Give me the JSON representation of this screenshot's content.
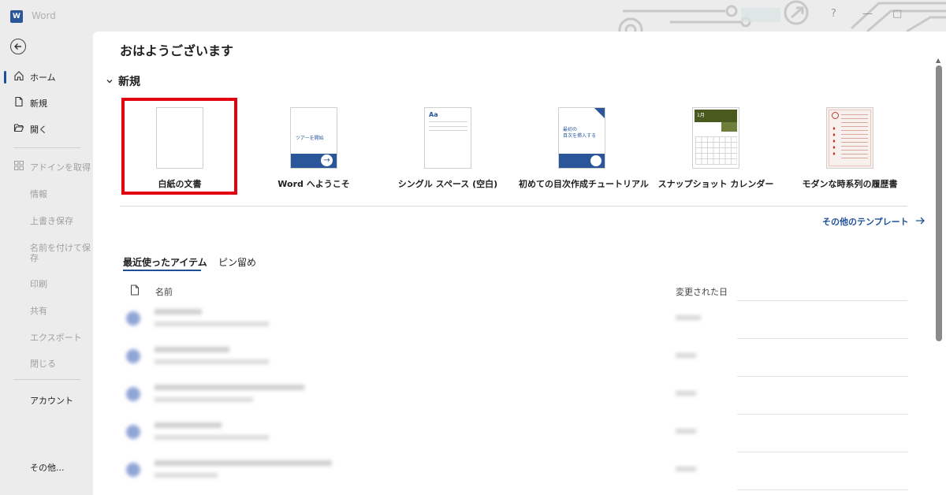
{
  "app": {
    "title": "Word",
    "icon_letter": "W",
    "help": "?",
    "minimize": "—",
    "maximize": "□"
  },
  "sidebar": {
    "back_icon": "back-arrow-icon",
    "items": [
      {
        "label": "ホーム",
        "icon": "home-icon",
        "active": true
      },
      {
        "label": "新規",
        "icon": "new-doc-icon"
      },
      {
        "label": "開く",
        "icon": "folder-open-icon"
      },
      {
        "label": "アドインを取得",
        "icon": "addins-grid-icon",
        "disabled": true
      },
      {
        "label": "情報",
        "disabled": true
      },
      {
        "label": "上書き保存",
        "disabled": true
      },
      {
        "label": "名前を付けて保",
        "disabled": true
      },
      {
        "label": "存",
        "disabled": true
      },
      {
        "label": "印刷",
        "disabled": true
      },
      {
        "label": "共有",
        "disabled": true
      },
      {
        "label": "エクスポート",
        "disabled": true
      },
      {
        "label": "閉じる",
        "disabled": true
      },
      {
        "label": "アカウント"
      },
      {
        "label": "その他..."
      }
    ]
  },
  "main": {
    "greeting": "おはようございます",
    "new_section": {
      "title": "新規",
      "collapse_icon": "chevron-down-icon"
    },
    "templates": [
      {
        "name": "白紙の文書"
      },
      {
        "name": "Word へようこそ",
        "thumb_text": "ツアーを開始"
      },
      {
        "name": "シングル スペース (空白)",
        "thumb_text": "Aa"
      },
      {
        "name": "初めての目次作成チュートリアル",
        "thumb_text_1": "最初の",
        "thumb_text_2": "目次を挿入する"
      },
      {
        "name": "スナップショット カレンダー",
        "thumb_text": "1月"
      },
      {
        "name": "モダンな時系列の履歴書"
      }
    ],
    "more_templates": "その他のテンプレート",
    "more_templates_icon": "arrow-right-icon",
    "tabs": [
      {
        "label": "最近使ったアイテム",
        "active": true
      },
      {
        "label": "ピン留め"
      }
    ],
    "columns": {
      "name": "名前",
      "modified": "変更された日"
    },
    "recent_rows": [
      {
        "title": "",
        "path": "",
        "date": ""
      },
      {
        "title": "",
        "path": "",
        "date": ""
      },
      {
        "title": "",
        "path": "",
        "date": ""
      },
      {
        "title": "",
        "path": "",
        "date": ""
      },
      {
        "title": "",
        "path": "",
        "date": ""
      }
    ]
  }
}
